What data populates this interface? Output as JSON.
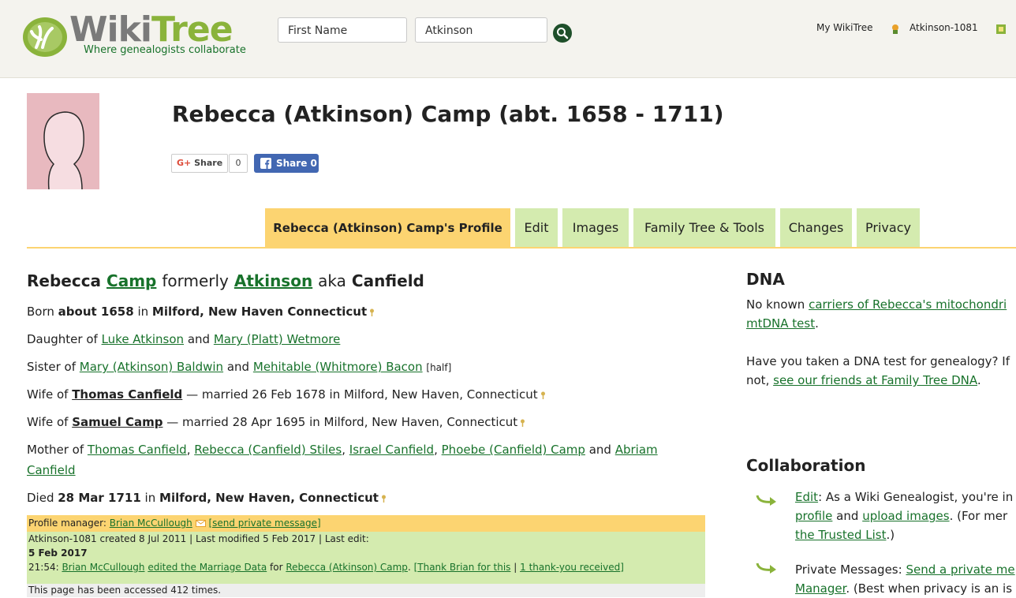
{
  "header": {
    "logo_wiki": "Wiki",
    "logo_tree": "Tree",
    "tagline": "Where genealogists collaborate",
    "search_first": "First Name",
    "search_last": "Atkinson",
    "my_wikitree": "My WikiTree",
    "user_id": "Atkinson-1081"
  },
  "profile": {
    "title": "Rebecca (Atkinson) Camp (abt. 1658 - 1711)",
    "gplus_share": "Share",
    "gplus_count": "0",
    "fb_share": "Share 0"
  },
  "tabs": [
    {
      "label": "Rebecca (Atkinson) Camp's Profile"
    },
    {
      "label": "Edit"
    },
    {
      "label": "Images"
    },
    {
      "label": "Family Tree & Tools"
    },
    {
      "label": "Changes"
    },
    {
      "label": "Privacy"
    }
  ],
  "bio": {
    "name_first": "Rebecca",
    "name_camp": "Camp",
    "formerly": "formerly",
    "name_atkinson": "Atkinson",
    "aka": "aka",
    "name_canfield": "Canfield",
    "born_prefix": "Born",
    "born_date": "about 1658",
    "born_in": "in",
    "born_place": "Milford, New Haven Connecticut",
    "daughter_prefix": "Daughter of",
    "father": "Luke Atkinson",
    "and1": "and",
    "mother": "Mary (Platt) Wetmore",
    "sister_prefix": "Sister of",
    "sister1": "Mary (Atkinson) Baldwin",
    "and2": "and",
    "sister2": "Mehitable (Whitmore) Bacon",
    "half": "[half]",
    "wife1_prefix": "Wife of",
    "husband1": "Thomas Canfield",
    "wife1_rest": "— married 26 Feb 1678 in Milford, New Haven, Connecticut",
    "wife2_prefix": "Wife of",
    "husband2": "Samuel Camp",
    "wife2_rest": "— married 28 Apr 1695 in Milford, New Haven, Connecticut",
    "mother_prefix": "Mother of",
    "child1": "Thomas Canfield",
    "child2": "Rebecca (Canfield) Stiles",
    "child3": "Israel Canfield",
    "child4": "Phoebe (Canfield) Camp",
    "and3": "and",
    "child5a": "Abriam",
    "child5b": "Canfield",
    "died_prefix": "Died",
    "died_date": "28 Mar 1711",
    "died_in": "in",
    "died_place": "Milford, New Haven, Connecticut"
  },
  "manager": {
    "prefix": "Profile manager:",
    "name": "Brian McCullough",
    "send": "[send private message]"
  },
  "meta": {
    "created": "Atkinson-1081 created 8 Jul 2011 | Last modified 5 Feb 2017 | Last edit:",
    "date": "5 Feb 2017",
    "time": "21:54:",
    "editor": "Brian McCullough",
    "edited_link": "edited the Marriage Data",
    "for": "for",
    "profile_link": "Rebecca (Atkinson) Camp",
    "thank_open": "[",
    "thank": "Thank Brian for this",
    "sep": "|",
    "received": "1 thank-you received",
    "thank_close": "]",
    "accessed": "This page has been accessed 412 times."
  },
  "dna": {
    "heading": "DNA",
    "line1_prefix": "No known",
    "line1_link": "carriers of Rebecca's mitochondri",
    "line2_link": "mtDNA test",
    "line2_end": ".",
    "line3": "Have you taken a DNA test for genealogy? If",
    "line4_prefix": "not,",
    "line4_link": "see our friends at Family Tree DNA",
    "line4_end": "."
  },
  "collab": {
    "heading": "Collaboration",
    "edit_link": "Edit",
    "edit_text": ": As a Wiki Genealogist, you're in",
    "profile_link": "profile",
    "and": "and",
    "upload_link": "upload images",
    "for_more": ". (For mer",
    "trusted_link": "the Trusted List",
    "trusted_end": ".)",
    "pm_text": "Private Messages:",
    "pm_link": "Send a private me",
    "manager_link": "Manager",
    "manager_end": ". (Best when privacy is an is"
  },
  "colors": {
    "link": "#18722b",
    "tab_green": "#d4ebaf",
    "tab_gold": "#fcd471"
  }
}
